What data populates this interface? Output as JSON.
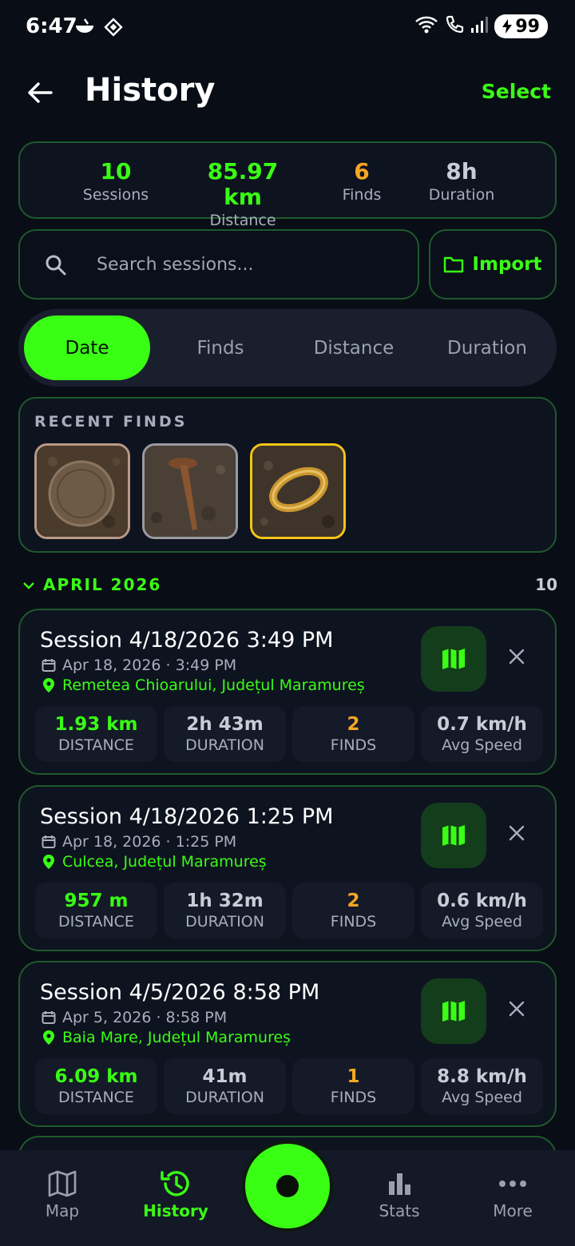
{
  "status_bar": {
    "time": "6:47",
    "battery": "99"
  },
  "header": {
    "title": "History",
    "select_label": "Select"
  },
  "summary": {
    "sessions": {
      "value": "10",
      "label": "Sessions"
    },
    "distance": {
      "value": "85.97 km",
      "label": "Distance"
    },
    "finds": {
      "value": "6",
      "label": "Finds"
    },
    "duration": {
      "value": "8h",
      "label": "Duration"
    }
  },
  "search": {
    "placeholder": "Search sessions..."
  },
  "import_label": "Import",
  "sort_tabs": [
    "Date",
    "Finds",
    "Distance",
    "Duration"
  ],
  "recent_finds": {
    "label": "RECENT FINDS"
  },
  "month": {
    "label": "APRIL 2026",
    "count": "10"
  },
  "sessions": [
    {
      "title": "Session 4/18/2026 3:49 PM",
      "date": "Apr 18, 2026 · 3:49 PM",
      "location": "Remetea Chioarului, Județul Maramureș",
      "distance": "1.93 km",
      "duration": "2h 43m",
      "finds": "2",
      "speed": "0.7 km/h"
    },
    {
      "title": "Session 4/18/2026 1:25 PM",
      "date": "Apr 18, 2026 · 1:25 PM",
      "location": "Culcea, Județul Maramureș",
      "distance": "957 m",
      "duration": "1h 32m",
      "finds": "2",
      "speed": "0.6 km/h"
    },
    {
      "title": "Session 4/5/2026 8:58 PM",
      "date": "Apr 5, 2026 · 8:58 PM",
      "location": "Baia Mare, Județul Maramureș",
      "distance": "6.09 km",
      "duration": "41m",
      "finds": "1",
      "speed": "8.8 km/h"
    }
  ],
  "stat_labels": {
    "distance": "DISTANCE",
    "duration": "DURATION",
    "finds": "FINDS",
    "speed": "Avg Speed"
  },
  "nav": {
    "map": "Map",
    "history": "History",
    "stats": "Stats",
    "more": "More"
  },
  "colors": {
    "accent": "#39ff14",
    "finds": "#f5a623",
    "background": "#090d16"
  }
}
